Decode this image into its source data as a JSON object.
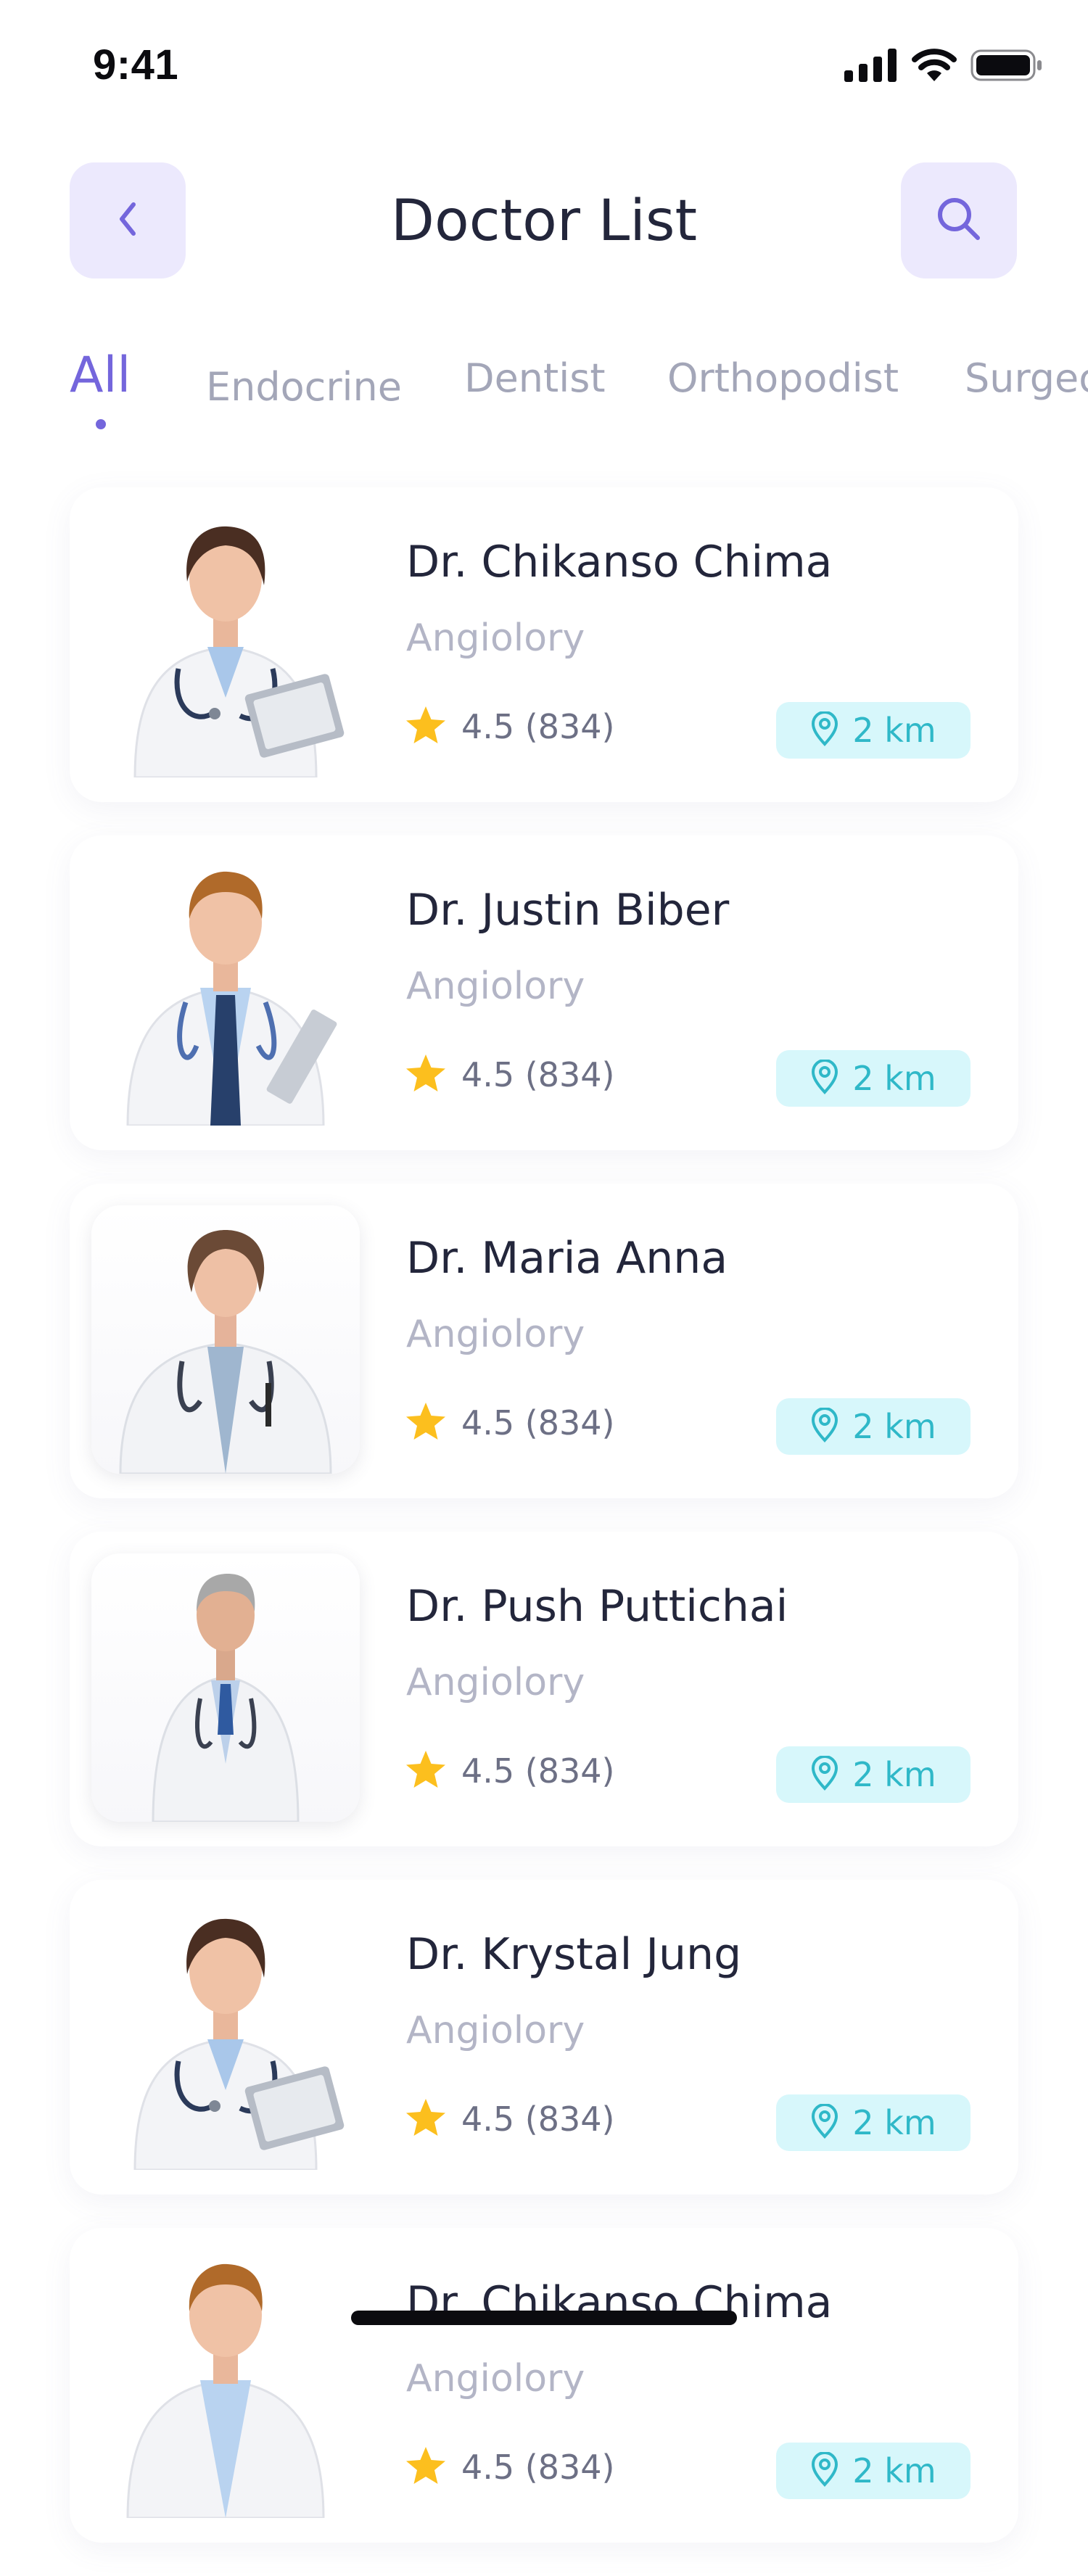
{
  "status_bar": {
    "time": "9:41"
  },
  "header": {
    "title": "Doctor List",
    "back_icon": "chevron-left-icon",
    "search_icon": "search-icon"
  },
  "tabs": [
    {
      "label": "All",
      "active": true
    },
    {
      "label": "Endocrine",
      "active": false
    },
    {
      "label": "Dentist",
      "active": false
    },
    {
      "label": "Orthopodist",
      "active": false
    },
    {
      "label": "Surgeon",
      "active": false
    }
  ],
  "doctors": [
    {
      "name": "Dr. Chikanso Chima",
      "specialty": "Angiolory",
      "rating": "4.5 (834)",
      "distance": "2 km"
    },
    {
      "name": "Dr. Justin Biber",
      "specialty": "Angiolory",
      "rating": "4.5 (834)",
      "distance": "2 km"
    },
    {
      "name": "Dr. Maria Anna",
      "specialty": "Angiolory",
      "rating": "4.5 (834)",
      "distance": "2 km"
    },
    {
      "name": "Dr. Push Puttichai",
      "specialty": "Angiolory",
      "rating": "4.5 (834)",
      "distance": "2 km"
    },
    {
      "name": "Dr. Krystal Jung",
      "specialty": "Angiolory",
      "rating": "4.5 (834)",
      "distance": "2 km"
    },
    {
      "name": "Dr. Chikanso Chima",
      "specialty": "Angiolory",
      "rating": "4.5 (834)",
      "distance": "2 km"
    }
  ],
  "colors": {
    "accent": "#7466dc",
    "accent_light": "#ece9fd",
    "star": "#fcbf1e",
    "distance_bg": "#d7f7fb",
    "distance_text": "#2fb8c8",
    "muted_text": "#b3b5c6"
  }
}
